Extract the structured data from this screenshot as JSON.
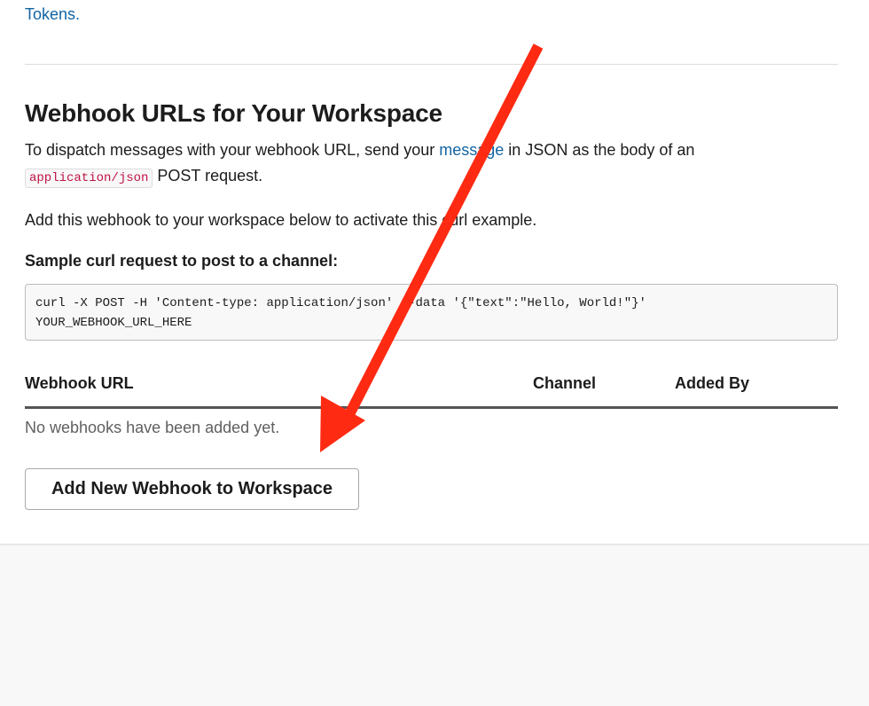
{
  "top_link": {
    "text": "Tokens."
  },
  "section": {
    "title": "Webhook URLs for Your Workspace",
    "intro_before": "To dispatch messages with your webhook URL, send your ",
    "intro_link": "message",
    "intro_after": " in JSON as the body of an",
    "content_type": "application/json",
    "intro_end": " POST request.",
    "activate_text": "Add this webhook to your workspace below to activate this curl example.",
    "sample_label": "Sample curl request to post to a channel:",
    "curl_line1": "curl -X POST -H 'Content-type: application/json' --data '{\"text\":\"Hello, World!\"}'",
    "curl_line2": "YOUR_WEBHOOK_URL_HERE"
  },
  "table": {
    "columns": [
      "Webhook URL",
      "Channel",
      "Added By"
    ],
    "empty_text": "No webhooks have been added yet."
  },
  "actions": {
    "add_button_label": "Add New Webhook to Workspace"
  },
  "annotation": {
    "arrow_color": "#ff2a12"
  },
  "colors": {
    "link": "#1264a3",
    "code_text": "#c01343",
    "background": "#f8f8f8",
    "card": "#ffffff"
  }
}
